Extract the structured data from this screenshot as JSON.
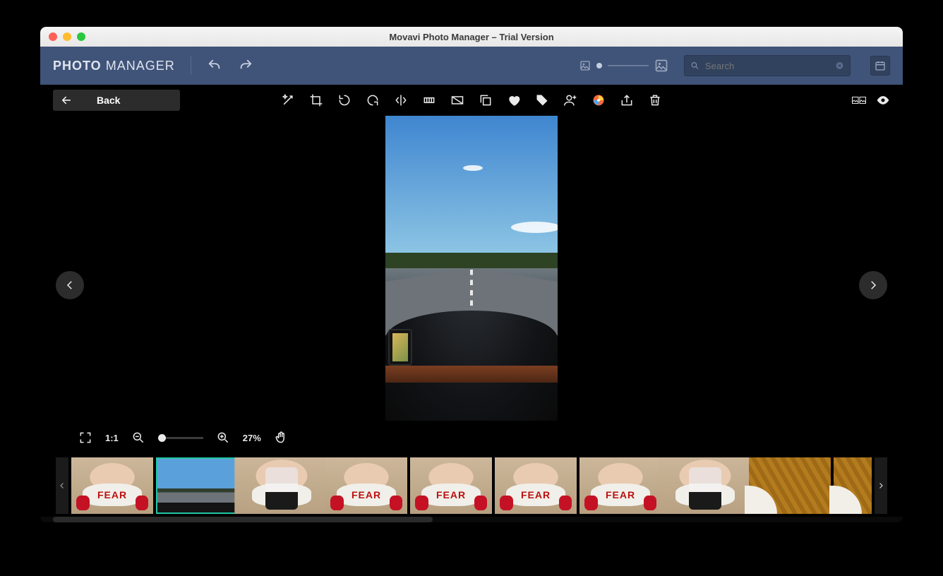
{
  "window": {
    "title": "Movavi Photo Manager – Trial Version"
  },
  "brand": {
    "bold": "PHOTO",
    "light": "MANAGER"
  },
  "toolbar": {
    "undo_icon": "undo",
    "redo_icon": "redo",
    "search_placeholder": "Search"
  },
  "subbar": {
    "back_label": "Back",
    "tools": [
      "magic-enhance",
      "crop",
      "rotate-left",
      "rotate-right",
      "flip-horizontal",
      "straighten",
      "resize",
      "copy",
      "favorite",
      "tag",
      "add-people",
      "edit-in-photo-editor",
      "export",
      "delete"
    ],
    "right_tools": [
      "compare",
      "view-toggle"
    ]
  },
  "viewer": {
    "zoom": {
      "fullscreen_icon": "fullscreen",
      "actual_label": "1:1",
      "zoom_out_icon": "zoom-out",
      "zoom_in_icon": "zoom-in",
      "percent": "27%",
      "pan_icon": "hand"
    }
  },
  "filmstrip": {
    "items": [
      {
        "kind": "fear",
        "selected": false
      },
      {
        "kind": "sky",
        "selected": true
      },
      {
        "kind": "person",
        "selected": false
      },
      {
        "kind": "fear",
        "selected": false
      },
      {
        "kind": "fear",
        "selected": false
      },
      {
        "kind": "fear",
        "selected": false
      },
      {
        "kind": "fear",
        "selected": false
      },
      {
        "kind": "person",
        "selected": false
      },
      {
        "kind": "wood",
        "selected": false
      },
      {
        "kind": "wood",
        "selected": false
      }
    ],
    "fear_word": "FEAR"
  }
}
